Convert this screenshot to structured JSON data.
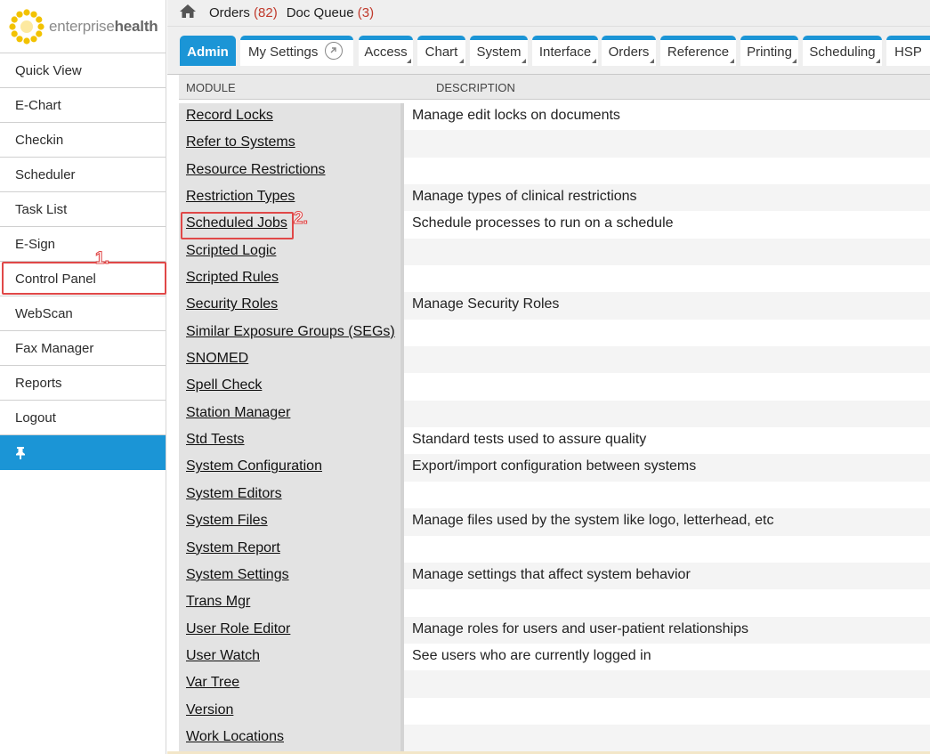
{
  "brand": {
    "light": "enterprise",
    "bold": "health"
  },
  "sidebar": {
    "items": [
      {
        "label": "Quick View"
      },
      {
        "label": "E-Chart"
      },
      {
        "label": "Checkin"
      },
      {
        "label": "Scheduler"
      },
      {
        "label": "Task List"
      },
      {
        "label": "E-Sign"
      },
      {
        "label": "Control Panel"
      },
      {
        "label": "WebScan"
      },
      {
        "label": "Fax Manager"
      },
      {
        "label": "Reports"
      },
      {
        "label": "Logout"
      }
    ],
    "pin_icon": "pin-icon"
  },
  "topbar": {
    "home_icon": "home-icon",
    "orders_label": "Orders",
    "orders_count": "(82)",
    "docqueue_label": "Doc Queue",
    "docqueue_count": "(3)"
  },
  "tabs": [
    {
      "label": "Admin",
      "active": true
    },
    {
      "label": "My Settings"
    },
    {
      "label": "Access"
    },
    {
      "label": "Chart"
    },
    {
      "label": "System"
    },
    {
      "label": "Interface"
    },
    {
      "label": "Orders"
    },
    {
      "label": "Reference"
    },
    {
      "label": "Printing"
    },
    {
      "label": "Scheduling"
    },
    {
      "label": "HSP"
    }
  ],
  "table": {
    "col_module": "MODULE",
    "col_description": "DESCRIPTION",
    "rows": [
      {
        "module": "Record Locks",
        "description": "Manage edit locks on documents"
      },
      {
        "module": "Refer to Systems",
        "description": ""
      },
      {
        "module": "Resource Restrictions",
        "description": ""
      },
      {
        "module": "Restriction Types",
        "description": "Manage types of clinical restrictions"
      },
      {
        "module": "Scheduled Jobs",
        "description": "Schedule processes to run on a schedule"
      },
      {
        "module": "Scripted Logic",
        "description": ""
      },
      {
        "module": "Scripted Rules",
        "description": ""
      },
      {
        "module": "Security Roles",
        "description": "Manage Security Roles"
      },
      {
        "module": "Similar Exposure Groups (SEGs)",
        "description": ""
      },
      {
        "module": "SNOMED",
        "description": ""
      },
      {
        "module": "Spell Check",
        "description": ""
      },
      {
        "module": "Station Manager",
        "description": ""
      },
      {
        "module": "Std Tests",
        "description": "Standard tests used to assure quality"
      },
      {
        "module": "System Configuration",
        "description": "Export/import configuration between systems"
      },
      {
        "module": "System Editors",
        "description": ""
      },
      {
        "module": "System Files",
        "description": "Manage files used by the system like logo, letterhead, etc"
      },
      {
        "module": "System Report",
        "description": ""
      },
      {
        "module": "System Settings",
        "description": "Manage settings that affect system behavior"
      },
      {
        "module": "Trans Mgr",
        "description": ""
      },
      {
        "module": "User Role Editor",
        "description": "Manage roles for users and user-patient relationships"
      },
      {
        "module": "User Watch",
        "description": "See users who are currently logged in"
      },
      {
        "module": "Var Tree",
        "description": ""
      },
      {
        "module": "Version",
        "description": ""
      },
      {
        "module": "Work Locations",
        "description": ""
      }
    ]
  },
  "annotations": {
    "step1": "1.",
    "step2": "2.",
    "color": "#e04848"
  },
  "colors": {
    "accent": "#1b95d6",
    "count": "#c0392b"
  }
}
